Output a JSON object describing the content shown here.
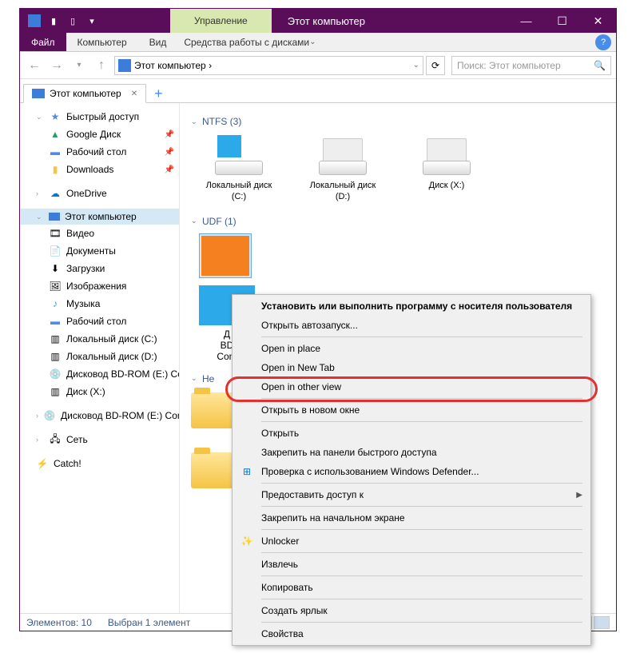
{
  "titlebar": {
    "manage": "Управление",
    "title": "Этот компьютер"
  },
  "ribbon": {
    "file": "Файл",
    "home": "Компьютер",
    "view": "Вид",
    "tools": "Средства работы с дисками"
  },
  "nav": {
    "breadcrumb": "Этот компьютер ›",
    "search_placeholder": "Поиск: Этот компьютер"
  },
  "tab": {
    "label": "Этот компьютер"
  },
  "sidebar": {
    "quick": "Быстрый доступ",
    "gdrive": "Google Диск",
    "desktop": "Рабочий стол",
    "downloads": "Downloads",
    "onedrive": "OneDrive",
    "thispc": "Этот компьютер",
    "video": "Видео",
    "docs": "Документы",
    "dl": "Загрузки",
    "pics": "Изображения",
    "music": "Музыка",
    "desk2": "Рабочий стол",
    "diskc": "Локальный диск (C:)",
    "diskd": "Локальный диск (D:)",
    "bdrom1": "Дисковод BD-ROM (E:) Co",
    "diskx": "Диск (X:)",
    "bdrom2": "Дисковод BD-ROM (E:) Com",
    "network": "Сеть",
    "catch": "Catch!"
  },
  "sections": {
    "ntfs": "NTFS (3)",
    "udf": "UDF (1)",
    "net": "Не"
  },
  "drives": {
    "c": "Локальный диск\n(C:)",
    "d": "Локальный диск\n(D:)",
    "x": "Диск (X:)",
    "bd1": "Д",
    "bd2": "BD",
    "bd3": "Com"
  },
  "status": {
    "items": "Элементов: 10",
    "selected": "Выбран 1 элемент"
  },
  "context": {
    "install": "Установить или выполнить программу с носителя пользователя",
    "autorun": "Открыть автозапуск...",
    "inplace": "Open in place",
    "newtab": "Open in New Tab",
    "otherview": "Open in other view",
    "newwindow": "Открыть в новом окне",
    "open": "Открыть",
    "pinquick": "Закрепить на панели быстрого доступа",
    "defender": "Проверка с использованием Windows Defender...",
    "share": "Предоставить доступ к",
    "pinstart": "Закрепить на начальном экране",
    "unlocker": "Unlocker",
    "eject": "Извлечь",
    "copy": "Копировать",
    "shortcut": "Создать ярлык",
    "props": "Свойства"
  }
}
